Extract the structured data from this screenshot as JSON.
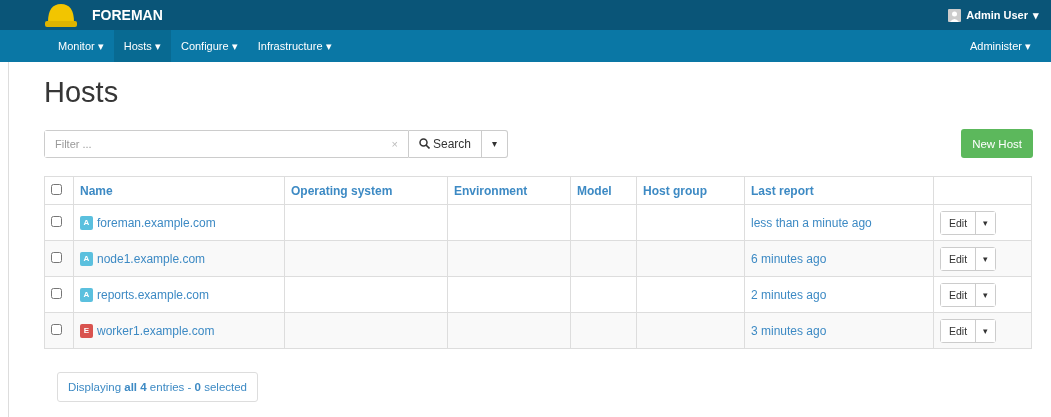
{
  "brand": {
    "title": "FOREMAN"
  },
  "user_menu": {
    "label": "Admin User",
    "caret": "▾"
  },
  "nav": {
    "items": [
      {
        "label": "Monitor",
        "caret": "▾",
        "selected": false
      },
      {
        "label": "Hosts",
        "caret": "▾",
        "selected": true
      },
      {
        "label": "Configure",
        "caret": "▾",
        "selected": false
      },
      {
        "label": "Infrastructure",
        "caret": "▾",
        "selected": false
      }
    ],
    "right": {
      "label": "Administer",
      "caret": "▾"
    }
  },
  "page_title": "Hosts",
  "search": {
    "placeholder": "Filter ...",
    "clear": "×",
    "button": "Search",
    "caret": "▾"
  },
  "new_button": "New Host",
  "table": {
    "select_all": {
      "checked": false
    },
    "columns": [
      "Name",
      "Operating system",
      "Environment",
      "Model",
      "Host group",
      "Last report"
    ],
    "rows": [
      {
        "checked": false,
        "status": "A",
        "color": "#5bc0de",
        "name": "foreman.example.com",
        "last_report": "less than a minute ago",
        "action": "Edit",
        "caret": "▾"
      },
      {
        "checked": false,
        "status": "A",
        "color": "#5bc0de",
        "name": "node1.example.com",
        "last_report": "6 minutes ago",
        "action": "Edit",
        "caret": "▾"
      },
      {
        "checked": false,
        "status": "A",
        "color": "#5bc0de",
        "name": "reports.example.com",
        "last_report": "2 minutes ago",
        "action": "Edit",
        "caret": "▾"
      },
      {
        "checked": false,
        "status": "E",
        "color": "#d9534f",
        "name": "worker1.example.com",
        "last_report": "3 minutes ago",
        "action": "Edit",
        "caret": "▾"
      }
    ]
  },
  "footer": "Displaying **all 4** entries - **0** selected"
}
